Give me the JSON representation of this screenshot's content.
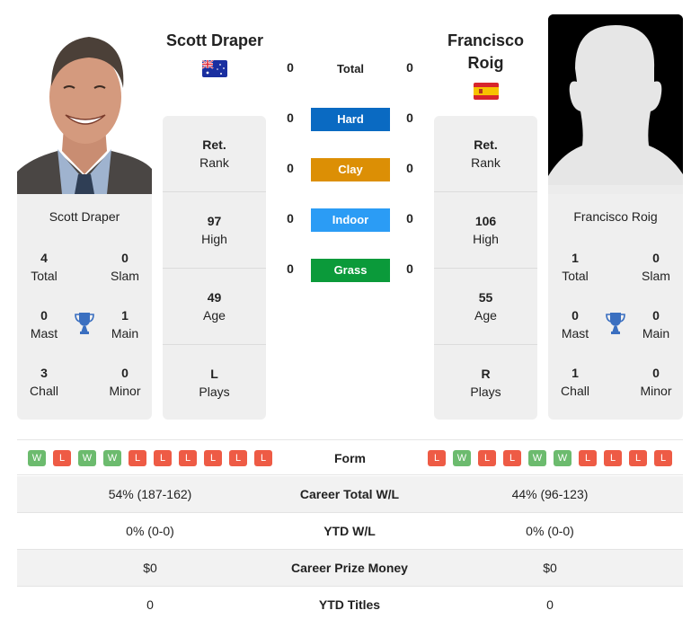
{
  "player_left": {
    "name": "Scott Draper",
    "country_flag": "australia-flag",
    "photo": "player-photo",
    "titles": {
      "total": {
        "value": "4",
        "label": "Total"
      },
      "slam": {
        "value": "0",
        "label": "Slam"
      },
      "mast": {
        "value": "0",
        "label": "Mast"
      },
      "main": {
        "value": "1",
        "label": "Main"
      },
      "chall": {
        "value": "3",
        "label": "Chall"
      },
      "minor": {
        "value": "0",
        "label": "Minor"
      }
    },
    "info": [
      {
        "value": "Ret.",
        "label": "Rank"
      },
      {
        "value": "97",
        "label": "High"
      },
      {
        "value": "49",
        "label": "Age"
      },
      {
        "value": "L",
        "label": "Plays"
      }
    ],
    "form": [
      "W",
      "L",
      "W",
      "W",
      "L",
      "L",
      "L",
      "L",
      "L",
      "L"
    ]
  },
  "player_right": {
    "name": "Francisco Roig",
    "name_line1": "Francisco",
    "name_line2": "Roig",
    "country_flag": "spain-flag",
    "photo": "silhouette-placeholder",
    "titles": {
      "total": {
        "value": "1",
        "label": "Total"
      },
      "slam": {
        "value": "0",
        "label": "Slam"
      },
      "mast": {
        "value": "0",
        "label": "Mast"
      },
      "main": {
        "value": "0",
        "label": "Main"
      },
      "chall": {
        "value": "1",
        "label": "Chall"
      },
      "minor": {
        "value": "0",
        "label": "Minor"
      }
    },
    "info": [
      {
        "value": "Ret.",
        "label": "Rank"
      },
      {
        "value": "106",
        "label": "High"
      },
      {
        "value": "55",
        "label": "Age"
      },
      {
        "value": "R",
        "label": "Plays"
      }
    ],
    "form": [
      "L",
      "W",
      "L",
      "L",
      "W",
      "W",
      "L",
      "L",
      "L",
      "L"
    ]
  },
  "h2h": {
    "total": {
      "label": "Total",
      "left": "0",
      "right": "0"
    },
    "surfaces": [
      {
        "label": "Hard",
        "left": "0",
        "right": "0",
        "color": "#0a6ac2"
      },
      {
        "label": "Clay",
        "left": "0",
        "right": "0",
        "color": "#dc8f05"
      },
      {
        "label": "Indoor",
        "left": "0",
        "right": "0",
        "color": "#2b9cf5"
      },
      {
        "label": "Grass",
        "left": "0",
        "right": "0",
        "color": "#0b9a3a"
      }
    ]
  },
  "form_label": "Form",
  "stats": [
    {
      "label": "Career Total W/L",
      "left": "54% (187-162)",
      "right": "44% (96-123)"
    },
    {
      "label": "YTD W/L",
      "left": "0% (0-0)",
      "right": "0% (0-0)"
    },
    {
      "label": "Career Prize Money",
      "left": "$0",
      "right": "$0"
    },
    {
      "label": "YTD Titles",
      "left": "0",
      "right": "0"
    }
  ],
  "colors": {
    "win": "#6cbb6e",
    "loss": "#ee5b45",
    "trophy": "#3a6fc0",
    "card_bg": "#efefef"
  }
}
